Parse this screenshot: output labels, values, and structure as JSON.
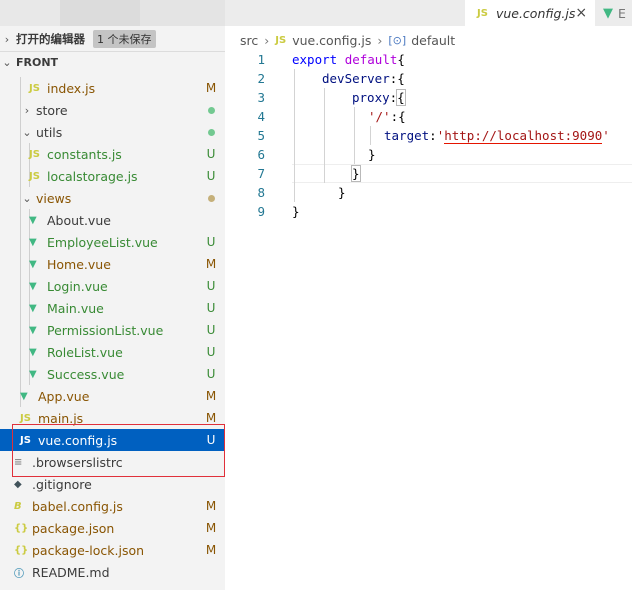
{
  "sidebar": {
    "open_editors": {
      "label": "打开的编辑器",
      "unsaved_badge": "1 个未保存"
    },
    "section_title": "FRONT",
    "items": [
      {
        "name": "index.js",
        "icon": "js-file-icon",
        "badge": "M"
      },
      {
        "name": "store",
        "icon": "folder-collapsed",
        "badge_dot": "green"
      },
      {
        "name": "utils",
        "icon": "folder-expanded",
        "badge_dot": "green"
      },
      {
        "name": "constants.js",
        "icon": "js-file-icon",
        "badge": "U"
      },
      {
        "name": "localstorage.js",
        "icon": "js-file-icon",
        "badge": "U"
      },
      {
        "name": "views",
        "icon": "folder-expanded",
        "badge_dot": "olive"
      },
      {
        "name": "About.vue",
        "icon": "vue-file-icon",
        "badge": ""
      },
      {
        "name": "EmployeeList.vue",
        "icon": "vue-file-icon",
        "badge": "U"
      },
      {
        "name": "Home.vue",
        "icon": "vue-file-icon",
        "badge": "M"
      },
      {
        "name": "Login.vue",
        "icon": "vue-file-icon",
        "badge": "U"
      },
      {
        "name": "Main.vue",
        "icon": "vue-file-icon",
        "badge": "U"
      },
      {
        "name": "PermissionList.vue",
        "icon": "vue-file-icon",
        "badge": "U"
      },
      {
        "name": "RoleList.vue",
        "icon": "vue-file-icon",
        "badge": "U"
      },
      {
        "name": "Success.vue",
        "icon": "vue-file-icon",
        "badge": "U"
      },
      {
        "name": "App.vue",
        "icon": "vue-file-icon",
        "badge": "M"
      },
      {
        "name": "main.js",
        "icon": "js-file-icon",
        "badge": "M"
      },
      {
        "name": "vue.config.js",
        "icon": "js-file-icon",
        "badge": "U",
        "selected": true
      },
      {
        "name": ".browserslistrc",
        "icon": "text-file-icon",
        "badge": ""
      },
      {
        "name": ".gitignore",
        "icon": "git-file-icon",
        "badge": ""
      },
      {
        "name": "babel.config.js",
        "icon": "babel-file-icon",
        "badge": "M"
      },
      {
        "name": "package.json",
        "icon": "json-file-icon",
        "badge": "M"
      },
      {
        "name": "package-lock.json",
        "icon": "json-file-icon",
        "badge": "M"
      },
      {
        "name": "README.md",
        "icon": "info-file-icon",
        "badge": ""
      }
    ]
  },
  "tabs": {
    "active": {
      "label": "vue.config.js",
      "icon_text": "JS",
      "close": "×"
    },
    "other": {
      "label": "E"
    }
  },
  "breadcrumb": {
    "folder": "src",
    "file": "vue.config.js",
    "symbol": "default",
    "file_icon_text": "JS",
    "symbol_icon": "[⊙]"
  },
  "code": {
    "line_numbers": [
      "1",
      "2",
      "3",
      "4",
      "5",
      "6",
      "7",
      "8",
      "9"
    ],
    "l1": {
      "kw1": "export",
      "kw2": "default",
      "p": "{"
    },
    "l2": {
      "prop": "devServer",
      "p": ":{"
    },
    "l3": {
      "prop": "proxy",
      "p1": ":",
      "p2": "{"
    },
    "l4": {
      "str": "'/'",
      "p": ":{"
    },
    "l5": {
      "prop": "target",
      "p1": ":",
      "url_q1": "'",
      "url": "http://localhost:9090",
      "url_q2": "'"
    },
    "l6": {
      "p": "}"
    },
    "l7": {
      "p": "}"
    },
    "l8": {
      "p": "}"
    },
    "l9": {
      "p": "}"
    }
  },
  "colors": {
    "selection": "#0060c0",
    "untracked": "#388a34",
    "modified": "#895503",
    "highlight_box": "#e0303a",
    "js_icon": "#cbcb41",
    "vue_icon": "#41b883"
  }
}
